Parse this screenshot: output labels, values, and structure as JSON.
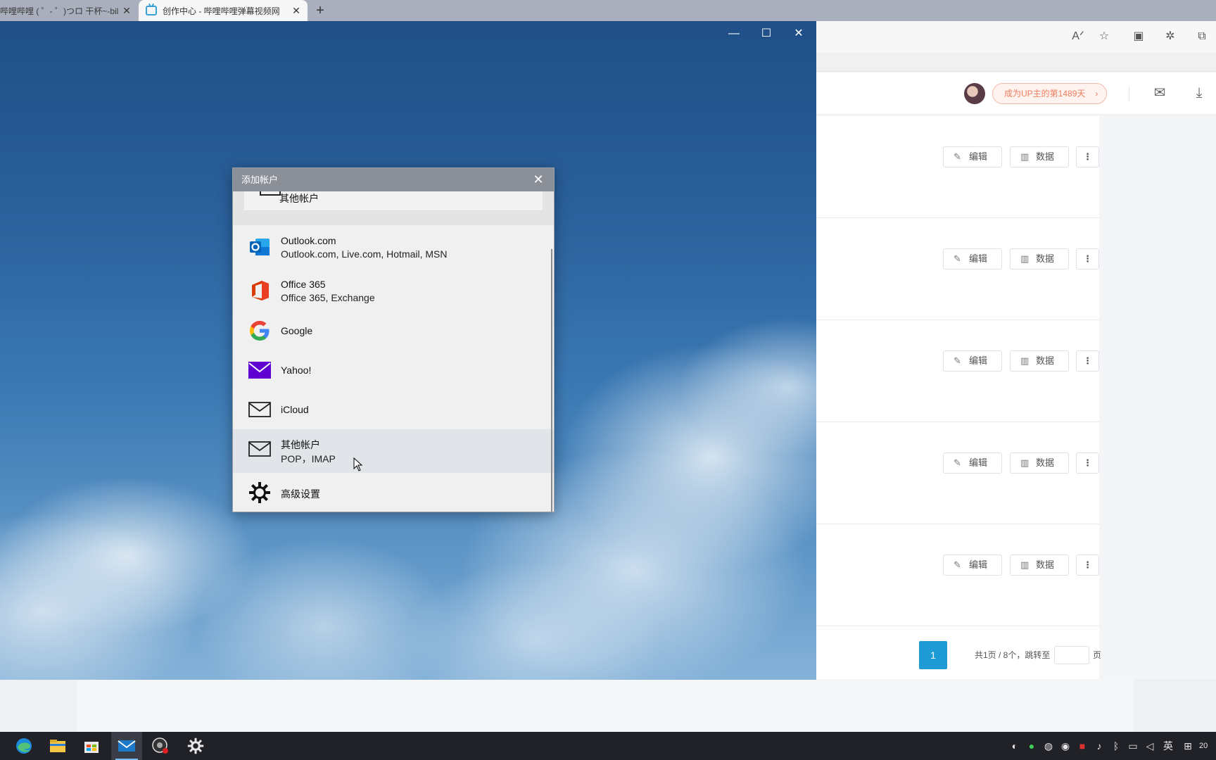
{
  "browser": {
    "tabs": [
      {
        "title": "哔哩哔哩 ( ゜- ゜)つロ 干杯~-bilibili",
        "active": false
      },
      {
        "title": "创作中心 - 哔哩哔哩弹幕视频网",
        "active": true
      }
    ],
    "new_tab_label": "+",
    "close_glyph": "✕"
  },
  "bilibili": {
    "up_badge": "成为UP主的第1489天",
    "badge_arrow": "›",
    "row_actions": {
      "edit": "编辑",
      "data": "数据",
      "more": "⋮"
    },
    "row_count": 5,
    "pagination": {
      "current_page": "1",
      "info": "共1页 / 8个，跳转至",
      "suffix": "页"
    }
  },
  "mail_window": {
    "controls": {
      "minimize": "—",
      "maximize": "☐",
      "close": "✕"
    }
  },
  "dialog": {
    "title": "添加帐户",
    "close_glyph": "✕",
    "top_tile_label": "其他帐户",
    "items": [
      {
        "name": "outlook",
        "line1": "Outlook.com",
        "line2": "Outlook.com, Live.com, Hotmail, MSN",
        "icon": "outlook-icon"
      },
      {
        "name": "office365",
        "line1": "Office 365",
        "line2": "Office 365, Exchange",
        "icon": "office-icon"
      },
      {
        "name": "google",
        "line1": "Google",
        "icon": "google-icon"
      },
      {
        "name": "yahoo",
        "line1": "Yahoo!",
        "icon": "yahoo-mail-icon"
      },
      {
        "name": "icloud",
        "line1": "iCloud",
        "icon": "envelope-icon"
      },
      {
        "name": "other",
        "line1": "其他帐户",
        "line2": "POP，IMAP",
        "icon": "envelope-icon"
      },
      {
        "name": "advanced",
        "line1": "高级设置",
        "icon": "gear-icon"
      }
    ]
  },
  "taskbar": {
    "apps": [
      "edge-icon",
      "file-explorer-icon",
      "store-icon",
      "mail-icon",
      "recorder-icon",
      "settings-icon"
    ],
    "ime_label": "英",
    "clock_fragment": "20"
  },
  "colors": {
    "accent": "#1e9bd4",
    "badge_text": "#f07c5d",
    "yahoo": "#5f01d1",
    "outlook": "#0f78d4",
    "office": "#d83b01"
  }
}
